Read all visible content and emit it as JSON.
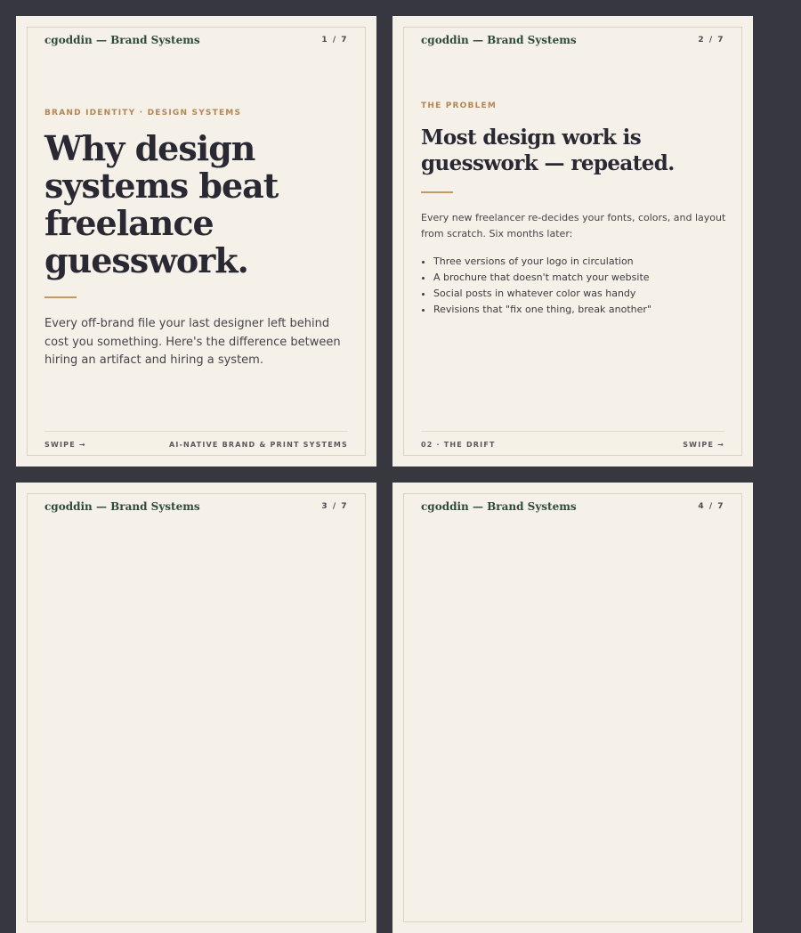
{
  "brand": "cgoddin — Brand Systems",
  "slides": [
    {
      "page": "1 / 7",
      "kicker": "BRAND IDENTITY · DESIGN SYSTEMS",
      "title_lines": [
        "Why design",
        "systems beat",
        "freelance",
        "guesswork."
      ],
      "body": "Every off-brand file your last designer left behind cost you something. Here's the difference between hiring an artifact and hiring a system.",
      "footer_left": "SWIPE →",
      "footer_right": "AI-NATIVE BRAND & PRINT SYSTEMS"
    },
    {
      "page": "2 / 7",
      "kicker": "THE PROBLEM",
      "title_lines": [
        "Most design work is",
        "guesswork — repeated."
      ],
      "body": "Every new freelancer re-decides your fonts, colors, and layout from scratch. Six months later:",
      "bullets": [
        "Three versions of your logo in circulation",
        "A brochure that doesn't match your website",
        "Social posts in whatever color was handy",
        "Revisions that \"fix one thing, break another\""
      ],
      "footer_left": "02 · THE DRIFT",
      "footer_right": "SWIPE →"
    },
    {
      "page": "3 / 7"
    },
    {
      "page": "4 / 7"
    }
  ]
}
